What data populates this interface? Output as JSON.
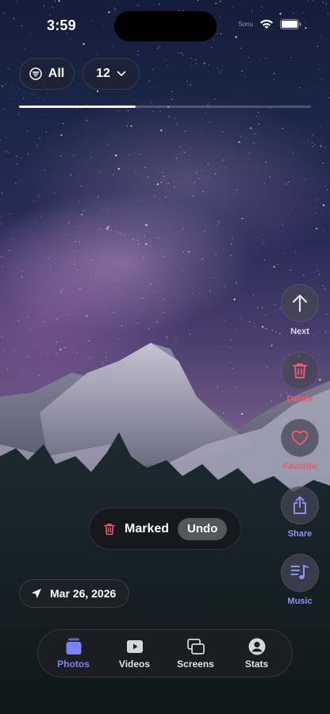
{
  "status_bar": {
    "time": "3:59",
    "carrier": "Sonu"
  },
  "filters": {
    "all_label": "All",
    "count_label": "12",
    "progress_fraction": 0.4
  },
  "actions": {
    "next_label": "Next",
    "delete_label": "Delete",
    "favorite_label": "Favorite",
    "share_label": "Share",
    "music_label": "Music"
  },
  "toast": {
    "message": "Marked",
    "undo_label": "Undo"
  },
  "photo_info": {
    "date": "Mar 26, 2026"
  },
  "tab_bar": {
    "tabs": [
      {
        "label": "Photos",
        "icon": "photos-icon",
        "active": true
      },
      {
        "label": "Videos",
        "icon": "videos-icon",
        "active": false
      },
      {
        "label": "Screens",
        "icon": "screens-icon",
        "active": false
      },
      {
        "label": "Stats",
        "icon": "stats-icon",
        "active": false
      }
    ]
  },
  "colors": {
    "accent": "#7b82f5",
    "delete": "#f0596b",
    "favorite": "#f0596b",
    "share": "#8f93f5",
    "music": "#8f93f5",
    "next": "#d8d8de",
    "inactive_tab": "#e0e0e6"
  }
}
